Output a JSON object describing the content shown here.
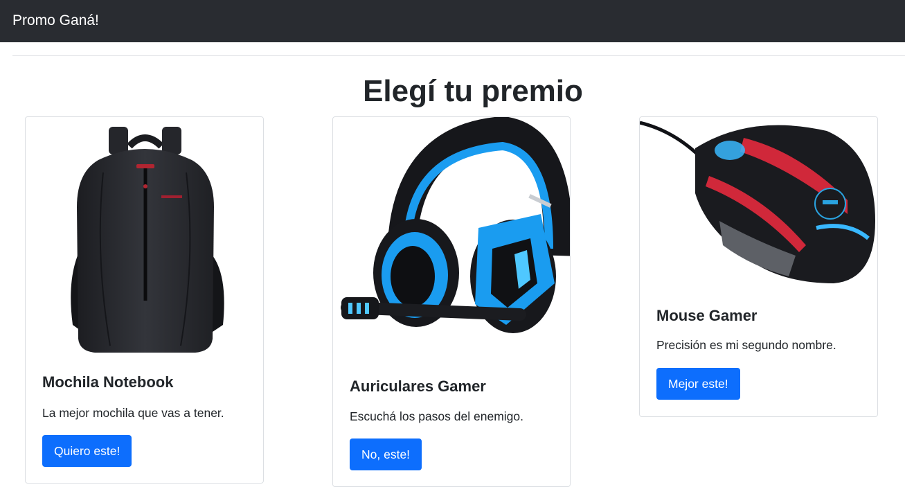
{
  "navbar": {
    "brand": "Promo Ganá!"
  },
  "main": {
    "title": "Elegí tu premio",
    "cards": [
      {
        "image_alt": "backpack-image",
        "title": "Mochila Notebook",
        "text": "La mejor mochila que vas a tener.",
        "button": "Quiero este!"
      },
      {
        "image_alt": "headphones-image",
        "title": "Auriculares Gamer",
        "text": "Escuchá los pasos del enemigo.",
        "button": "No, este!"
      },
      {
        "image_alt": "mouse-image",
        "title": "Mouse Gamer",
        "text": "Precisión es mi segundo nombre.",
        "button": "Mejor este!"
      }
    ]
  },
  "colors": {
    "navbar_bg": "#292c31",
    "primary_button": "#0d6efd",
    "card_border": "#dcdfe3",
    "headset_accent": "#1a9cf0",
    "mouse_accent": "#d0283a"
  }
}
